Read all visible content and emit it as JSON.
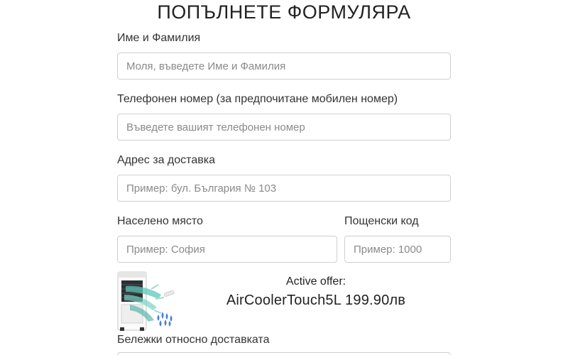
{
  "form": {
    "title": "ПОПЪЛНЕТЕ ФОРМУЛЯРА",
    "name": {
      "label": "Име и Фамилия",
      "placeholder": "Моля, въведете Име и Фамилия"
    },
    "phone": {
      "label": "Телефонен номер (за предпочитане мобилен номер)",
      "placeholder": "Въведете вашият телефонен номер"
    },
    "address": {
      "label": "Адрес за доставка",
      "placeholder": "Пример: бул. България № 103"
    },
    "city": {
      "label": "Населено място",
      "placeholder": "Пример: София"
    },
    "postcode": {
      "label": "Пощенски код",
      "placeholder": "Пример: 1000"
    },
    "notes": {
      "label": "Бележки относно доставката"
    }
  },
  "offer": {
    "caption": "Active offer:",
    "product": "AirCoolerTouch5L 199.90лв",
    "image_icon": "air-cooler-product-image"
  },
  "colors": {
    "text": "#222222",
    "border": "#cfcfcf",
    "placeholder": "#8a8a8a",
    "airflow": "#5ec6b8",
    "droplets": "#4a7fd6"
  }
}
